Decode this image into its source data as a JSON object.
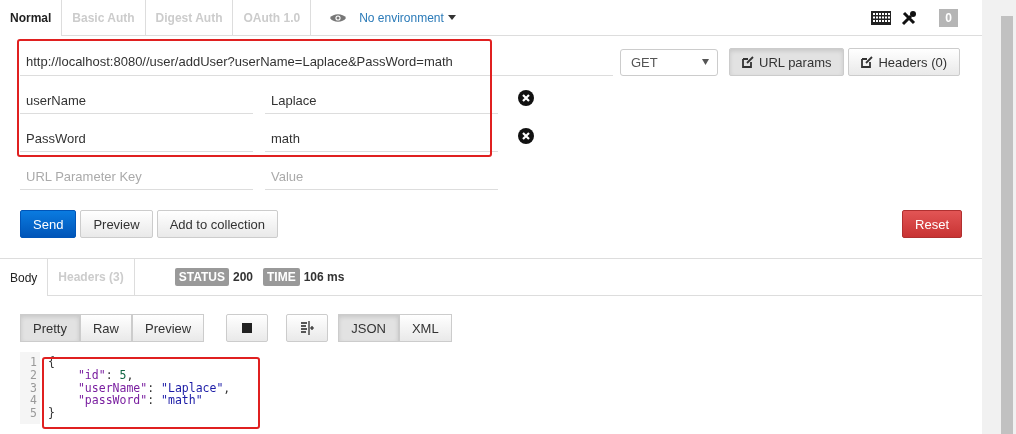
{
  "tabs": [
    {
      "label": "Normal",
      "selected": true
    },
    {
      "label": "Basic Auth",
      "selected": false
    },
    {
      "label": "Digest Auth",
      "selected": false
    },
    {
      "label": "OAuth 1.0",
      "selected": false
    }
  ],
  "environment": "No environment",
  "notification_count": "0",
  "request": {
    "url": "http://localhost:8080//user/addUser?userName=Laplace&PassWord=math",
    "method": "GET",
    "toggles": [
      {
        "label": "URL params",
        "selected": true
      },
      {
        "label": "Headers (0)",
        "selected": false
      }
    ],
    "params": [
      {
        "key": "userName",
        "value": "Laplace"
      },
      {
        "key": "PassWord",
        "value": "math"
      }
    ],
    "new_param": {
      "key_placeholder": "URL Parameter Key",
      "value_placeholder": "Value"
    }
  },
  "actions": [
    {
      "label": "Send",
      "kind": "primary"
    },
    {
      "label": "Preview",
      "kind": "default"
    },
    {
      "label": "Add to collection",
      "kind": "default"
    },
    {
      "label": "Reset",
      "kind": "danger"
    }
  ],
  "response": {
    "tabs": [
      {
        "label": "Body",
        "selected": true
      },
      {
        "label": "Headers (3)",
        "selected": false
      }
    ],
    "status_label": "STATUS",
    "status": "200",
    "time_label": "TIME",
    "time": "106 ms",
    "views": [
      {
        "label": "Pretty",
        "selected": true
      },
      {
        "label": "Raw",
        "selected": false
      },
      {
        "label": "Preview",
        "selected": false
      }
    ],
    "formats": [
      {
        "label": "JSON",
        "selected": true
      },
      {
        "label": "XML",
        "selected": false
      }
    ],
    "code": [
      {
        "number": "1",
        "indented": false,
        "tokens": [
          {
            "kind": "punct",
            "text": "{"
          }
        ]
      },
      {
        "number": "2",
        "indented": true,
        "tokens": [
          {
            "kind": "key",
            "text": "\"id\""
          },
          {
            "kind": "punct",
            "text": ": "
          },
          {
            "kind": "number",
            "text": "5"
          },
          {
            "kind": "punct",
            "text": ","
          }
        ]
      },
      {
        "number": "3",
        "indented": true,
        "tokens": [
          {
            "kind": "key",
            "text": "\"userName\""
          },
          {
            "kind": "punct",
            "text": ": "
          },
          {
            "kind": "string",
            "text": "\"Laplace\""
          },
          {
            "kind": "punct",
            "text": ","
          }
        ]
      },
      {
        "number": "4",
        "indented": true,
        "tokens": [
          {
            "kind": "key",
            "text": "\"passWord\""
          },
          {
            "kind": "punct",
            "text": ": "
          },
          {
            "kind": "string",
            "text": "\"math\""
          }
        ]
      },
      {
        "number": "5",
        "indented": false,
        "tokens": [
          {
            "kind": "punct",
            "text": "}"
          }
        ]
      }
    ]
  }
}
